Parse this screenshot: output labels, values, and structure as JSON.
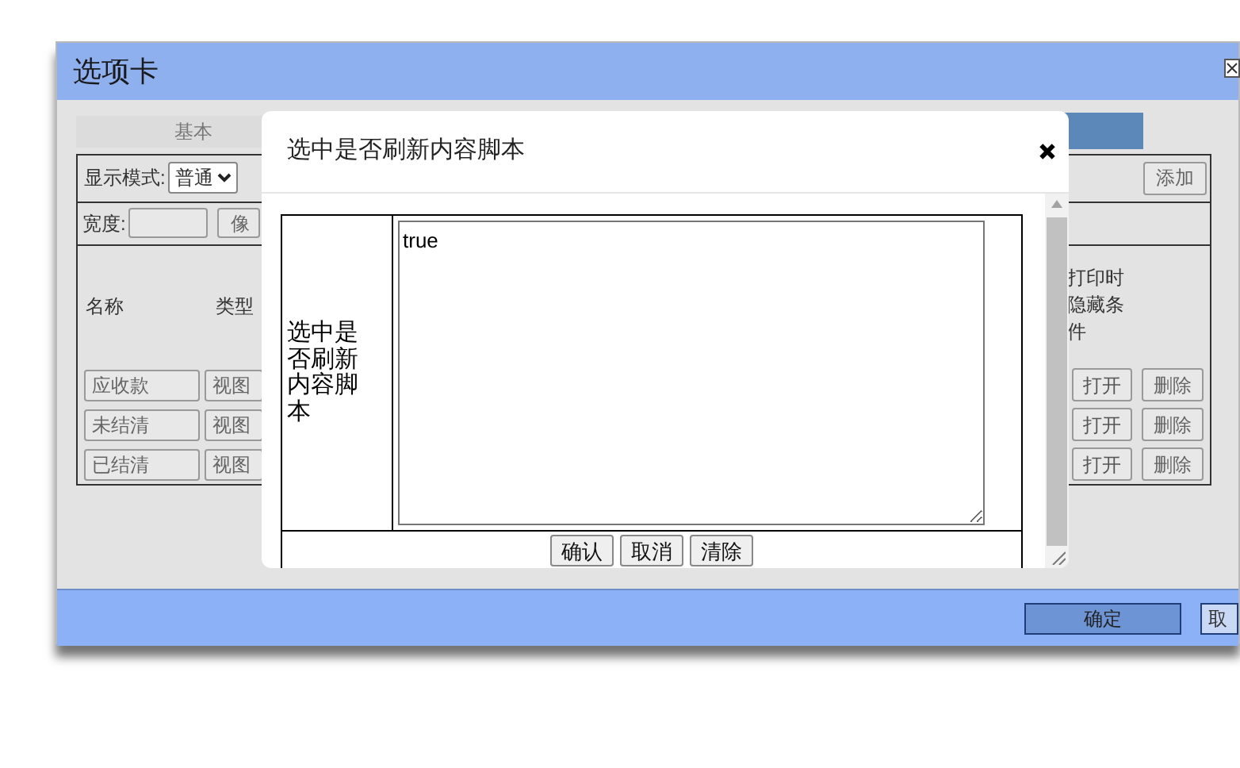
{
  "window": {
    "title": "选项卡"
  },
  "tabs": [
    {
      "label": "基本",
      "selected": false
    },
    {
      "selected": true
    }
  ],
  "display_mode": {
    "label": "显示模式:",
    "value": "普通"
  },
  "width_row": {
    "label": "宽度:",
    "unit_button": "像"
  },
  "columns": [
    "名称",
    "类型"
  ],
  "column_note": [
    "打印时",
    "隐藏条",
    "件"
  ],
  "add_button": "添加",
  "rows": [
    {
      "name": "应收款",
      "view_button": "视图",
      "open_button": "打开",
      "delete_button": "删除"
    },
    {
      "name": "未结清",
      "view_button": "视图",
      "open_button": "打开",
      "delete_button": "删除"
    },
    {
      "name": "已结清",
      "view_button": "视图",
      "open_button": "打开",
      "delete_button": "删除"
    }
  ],
  "dialog": {
    "title": "选中是否刷新内容脚本",
    "field_label": "选中是否刷新内容脚本",
    "value": "true",
    "buttons": [
      "确认",
      "取消",
      "清除"
    ]
  },
  "footer_buttons": [
    {
      "label": "确定",
      "kind": "primary"
    },
    {
      "label": "取",
      "kind": "plain"
    }
  ]
}
